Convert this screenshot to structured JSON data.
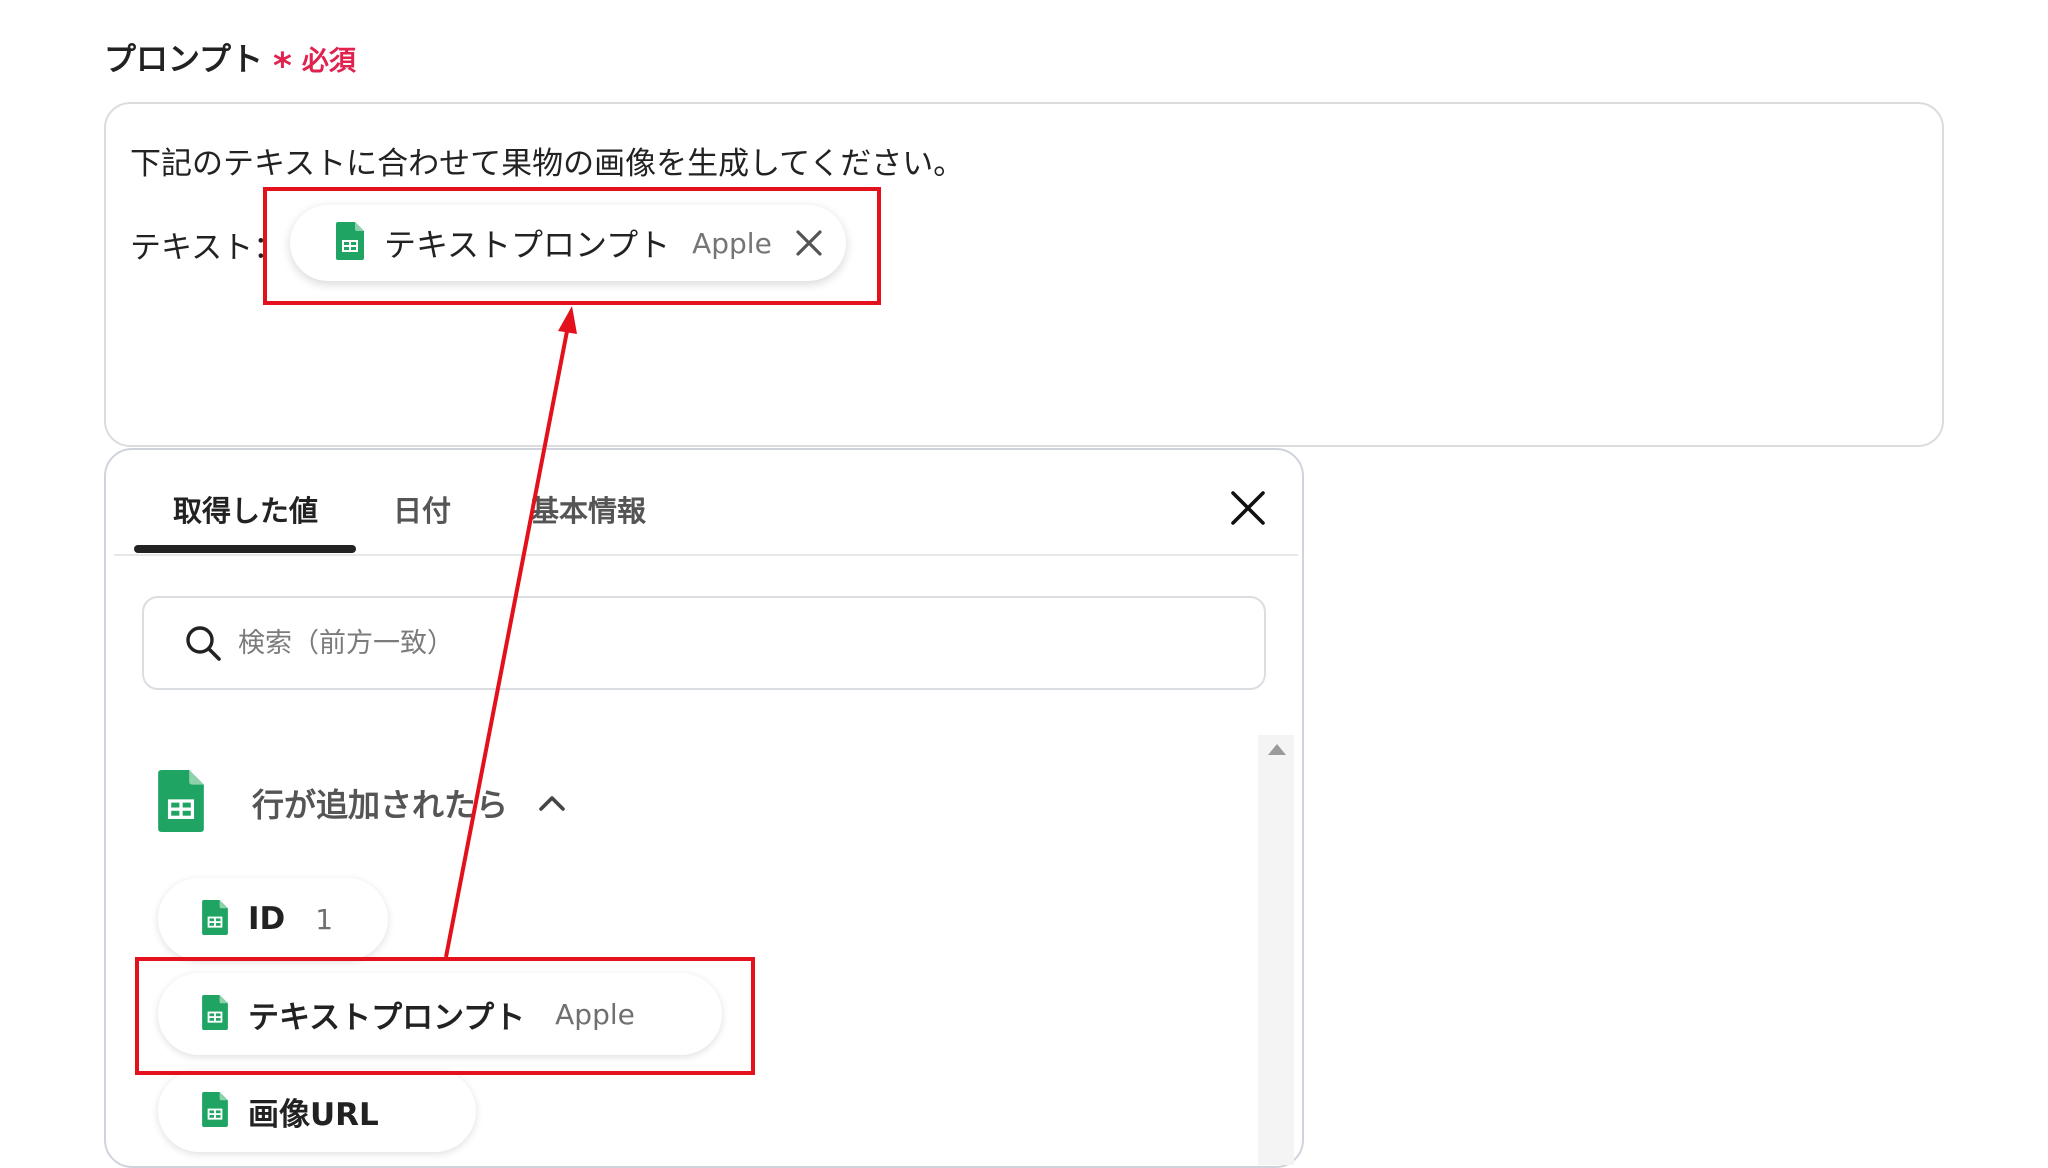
{
  "field": {
    "label": "プロンプト",
    "required_mark": "*",
    "required_text": "必須"
  },
  "prompt": {
    "line1": "下記のテキストに合わせて果物の画像を生成してください。",
    "line2_label": "テキスト：",
    "chip": {
      "title": "テキストプロンプト",
      "value": "Apple",
      "icon": "google-sheets-icon",
      "close_icon": "close-icon"
    }
  },
  "picker": {
    "tabs": [
      {
        "label": "取得した値",
        "active": true
      },
      {
        "label": "日付",
        "active": false
      },
      {
        "label": "基本情報",
        "active": false
      }
    ],
    "close_icon": "close-icon",
    "search": {
      "placeholder": "検索（前方一致）",
      "value": "",
      "icon": "search-icon"
    },
    "group": {
      "title": "行が追加されたら",
      "icon": "google-sheets-icon",
      "expanded": true
    },
    "items": [
      {
        "title": "ID",
        "value": "1"
      },
      {
        "title": "テキストプロンプト",
        "value": "Apple"
      },
      {
        "title": "画像URL",
        "value": ""
      }
    ]
  },
  "colors": {
    "sheets_green": "#1fa463",
    "highlight_red": "#e3111b",
    "required_red": "#e0224f"
  }
}
